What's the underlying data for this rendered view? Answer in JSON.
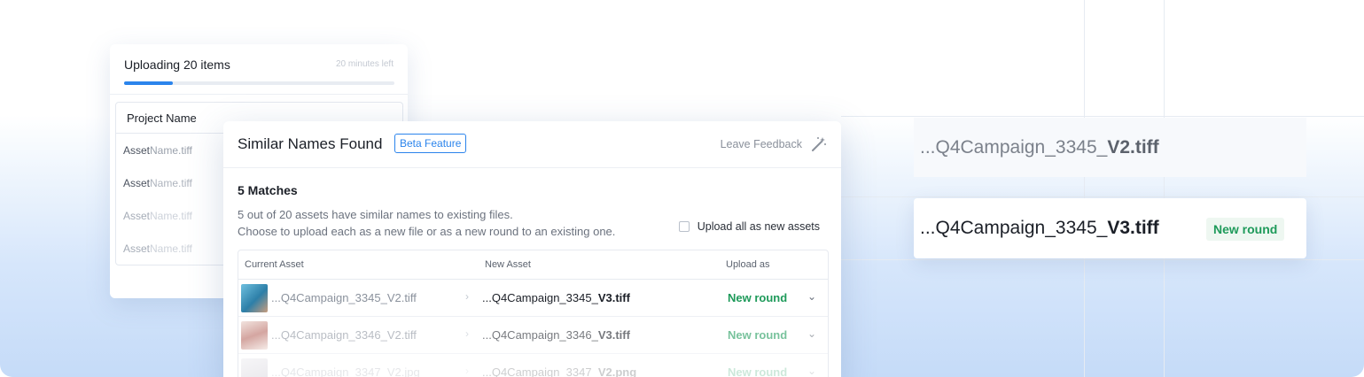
{
  "upload_panel": {
    "title": "Uploading 20 items",
    "time_left": "20 minutes left",
    "progress_fraction": 0.18,
    "project_label": "Project Name",
    "assets": [
      {
        "prefix": "Asset",
        "name": "Name.tiff"
      },
      {
        "prefix": "Asset",
        "name": "Name.tiff"
      },
      {
        "prefix": "Asset",
        "name": "Name.tiff"
      },
      {
        "prefix": "Asset",
        "name": "Name.tiff"
      }
    ]
  },
  "dialog": {
    "title": "Similar Names Found",
    "badge": "Beta Feature",
    "feedback": "Leave Feedback",
    "feedback_icon": "magic-wand-icon",
    "matches": "5 Matches",
    "desc_line1": "5 out of 20 assets have similar names to existing files.",
    "desc_line2": "Choose to upload each as a new file or as a new round to an existing one.",
    "upload_all_label": "Upload all as new assets",
    "upload_all_checked": false,
    "columns": {
      "current": "Current Asset",
      "new": "New Asset",
      "upload_as": "Upload as"
    },
    "rows": [
      {
        "current": "...Q4Campaign_3345_V2.tiff",
        "new_prefix": "...Q4Campaign_3345_",
        "new_version": "V3.tiff",
        "upload_as": "New round",
        "thumb_color": "#3f9ec7"
      },
      {
        "current": "...Q4Campaign_3346_V2.tiff",
        "new_prefix": "...Q4Campaign_3346_",
        "new_version": "V3.tiff",
        "upload_as": "New round",
        "thumb_color": "#c98f8a"
      },
      {
        "current": "...Q4Campaign_3347_V2.jpg",
        "new_prefix": "...Q4Campaign_3347_",
        "new_version": "V2.png",
        "upload_as": "New round",
        "thumb_color": "#b9b5c2"
      }
    ]
  },
  "compare_cards": {
    "old_prefix": "...Q4Campaign_3345_",
    "old_version": "V2.tiff",
    "new_prefix": "...Q4Campaign_3345_",
    "new_version": "V3.tiff",
    "new_badge": "New round"
  },
  "colors": {
    "accent": "#2b84ec",
    "success": "#1e9a5a"
  }
}
